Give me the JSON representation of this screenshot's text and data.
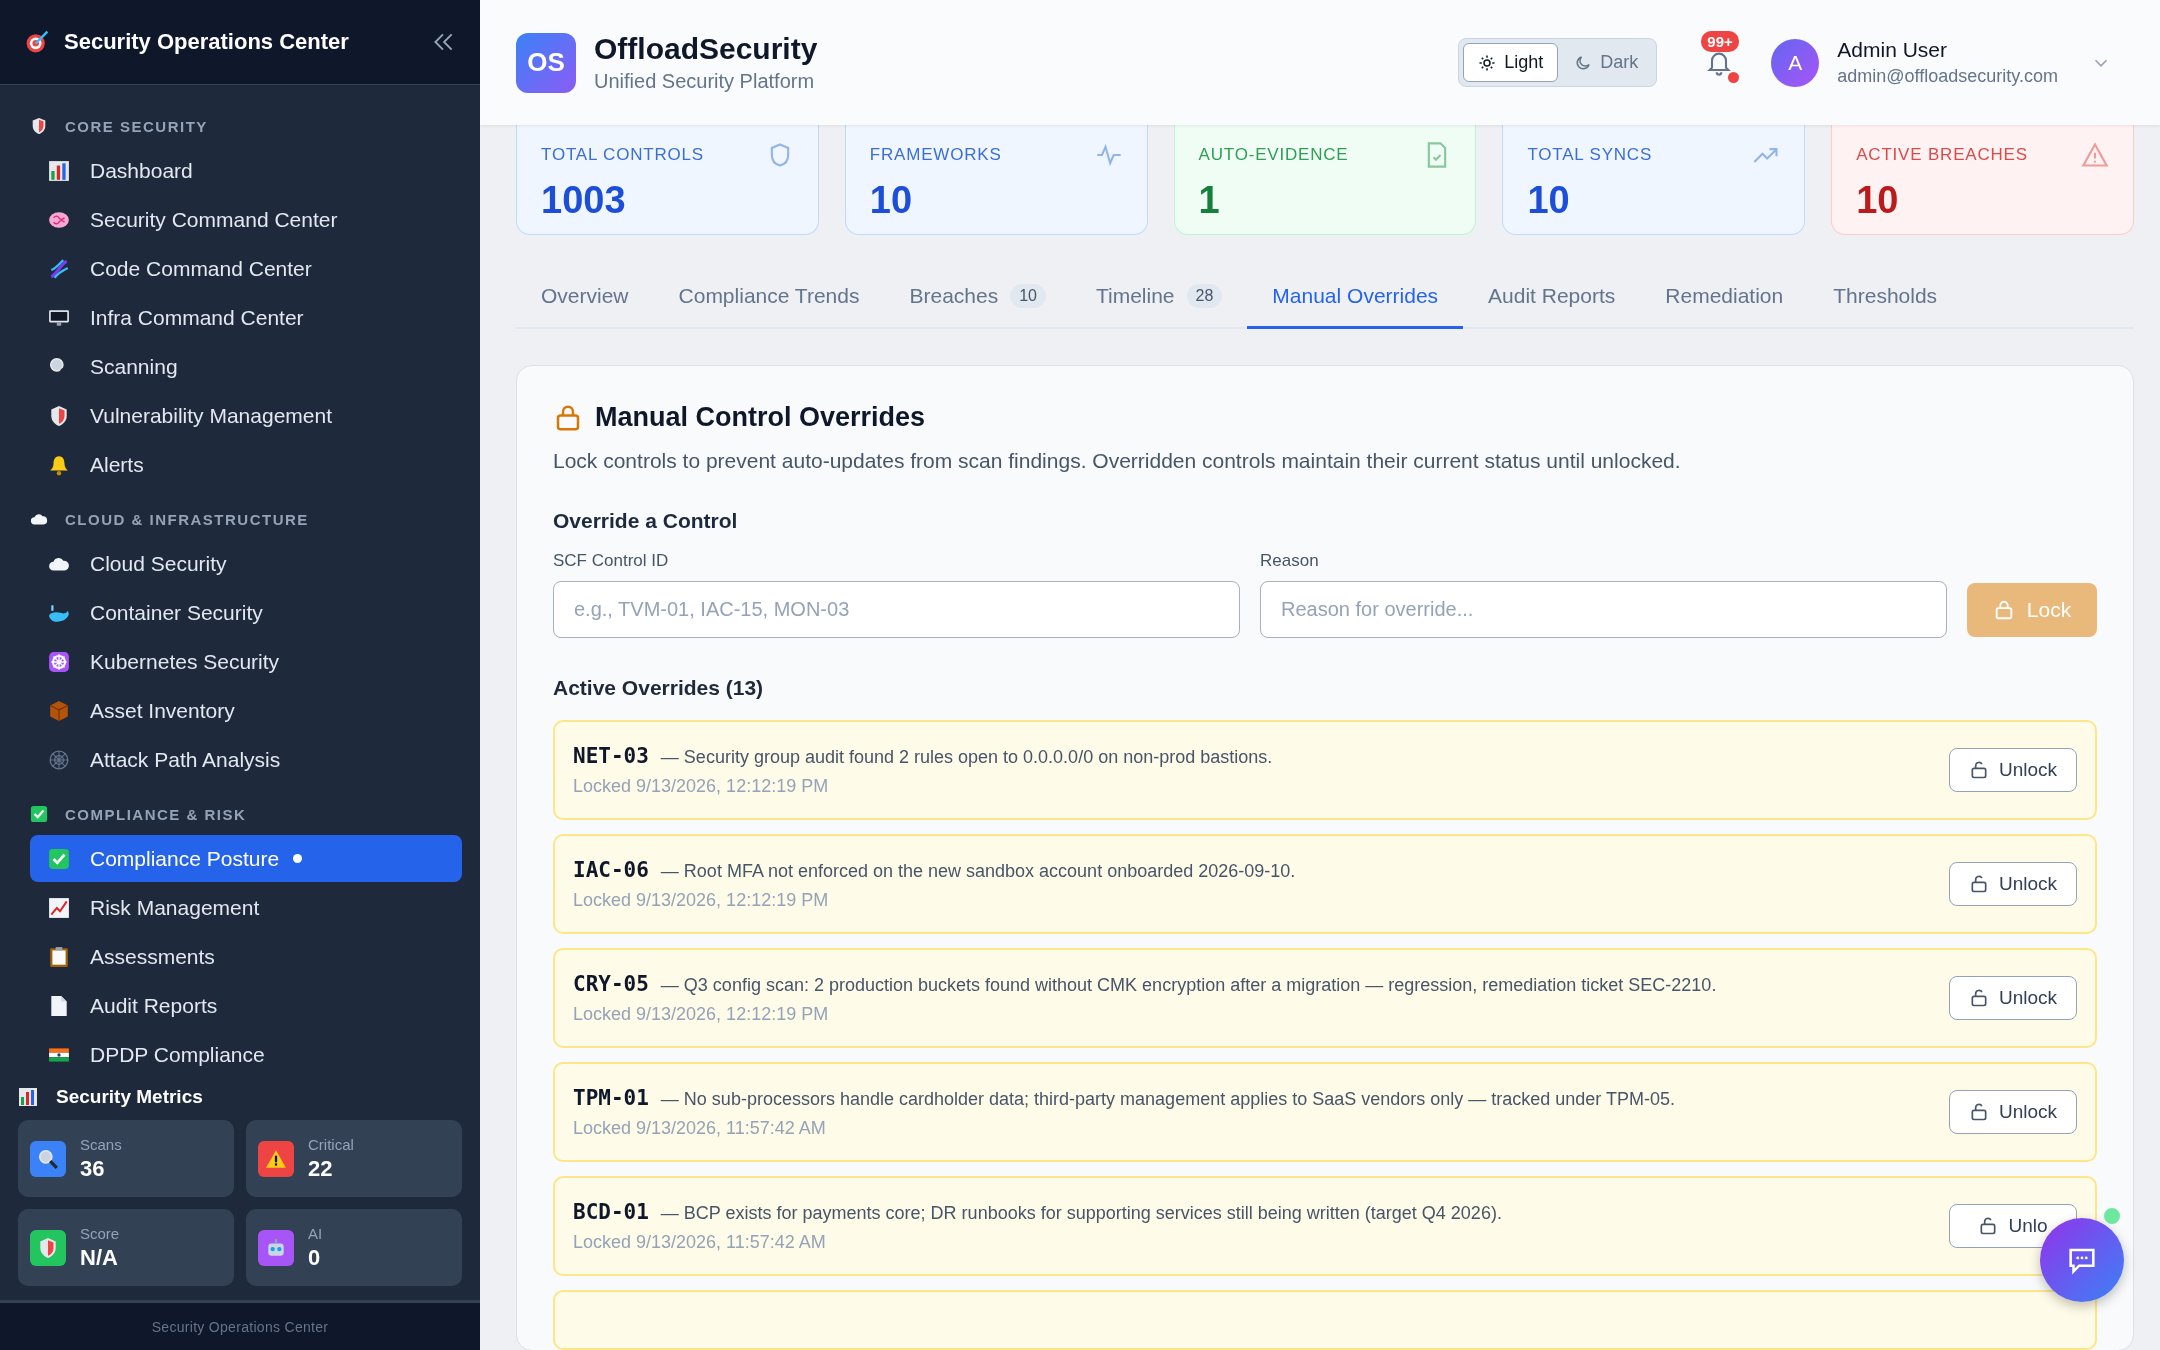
{
  "sidebar": {
    "title": "Security Operations Center",
    "sections": [
      {
        "label": "CORE SECURITY",
        "items": [
          {
            "label": "Dashboard",
            "selected": false
          },
          {
            "label": "Security Command Center",
            "selected": false
          },
          {
            "label": "Code Command Center",
            "selected": false
          },
          {
            "label": "Infra Command Center",
            "selected": false
          },
          {
            "label": "Scanning",
            "selected": false
          },
          {
            "label": "Vulnerability Management",
            "selected": false
          },
          {
            "label": "Alerts",
            "selected": false
          }
        ]
      },
      {
        "label": "CLOUD & INFRASTRUCTURE",
        "items": [
          {
            "label": "Cloud Security",
            "selected": false
          },
          {
            "label": "Container Security",
            "selected": false
          },
          {
            "label": "Kubernetes Security",
            "selected": false
          },
          {
            "label": "Asset Inventory",
            "selected": false
          },
          {
            "label": "Attack Path Analysis",
            "selected": false
          }
        ]
      },
      {
        "label": "COMPLIANCE & RISK",
        "items": [
          {
            "label": "Compliance Posture",
            "selected": true
          },
          {
            "label": "Risk Management",
            "selected": false
          },
          {
            "label": "Assessments",
            "selected": false
          },
          {
            "label": "Audit Reports",
            "selected": false
          },
          {
            "label": "DPDP Compliance",
            "selected": false
          }
        ]
      }
    ],
    "metrics_title": "Security Metrics",
    "metrics": [
      {
        "label": "Scans",
        "value": "36"
      },
      {
        "label": "Critical",
        "value": "22"
      },
      {
        "label": "Score",
        "value": "N/A"
      },
      {
        "label": "AI",
        "value": "0"
      }
    ],
    "footer": "Security Operations Center"
  },
  "header": {
    "logo": "OS",
    "title": "OffloadSecurity",
    "subtitle": "Unified Security Platform",
    "theme": [
      {
        "label": "Light",
        "selected": true
      },
      {
        "label": "Dark",
        "selected": false
      }
    ],
    "notifications": "99+",
    "user": {
      "initial": "A",
      "name": "Admin User",
      "email": "admin@offloadsecurity.com"
    }
  },
  "stats": [
    {
      "label": "TOTAL CONTROLS",
      "value": "1003",
      "kind": "info"
    },
    {
      "label": "FRAMEWORKS",
      "value": "10",
      "kind": "info"
    },
    {
      "label": "AUTO-EVIDENCE",
      "value": "1",
      "kind": "success"
    },
    {
      "label": "TOTAL SYNCS",
      "value": "10",
      "kind": "info"
    },
    {
      "label": "ACTIVE BREACHES",
      "value": "10",
      "kind": "danger"
    }
  ],
  "tabs": [
    {
      "label": "Overview",
      "selected": false
    },
    {
      "label": "Compliance Trends",
      "selected": false
    },
    {
      "label": "Breaches",
      "count": "10",
      "selected": false
    },
    {
      "label": "Timeline",
      "count": "28",
      "selected": false
    },
    {
      "label": "Manual Overrides",
      "selected": true
    },
    {
      "label": "Audit Reports",
      "selected": false
    },
    {
      "label": "Remediation",
      "selected": false
    },
    {
      "label": "Thresholds",
      "selected": false
    }
  ],
  "panel": {
    "title": "Manual Control Overrides",
    "description": "Lock controls to prevent auto-updates from scan findings. Overridden controls maintain their current status until unlocked.",
    "form_title": "Override a Control",
    "fields": [
      {
        "label": "SCF Control ID",
        "placeholder": "e.g., TVM-01, IAC-15, MON-03"
      },
      {
        "label": "Reason",
        "placeholder": "Reason for override..."
      }
    ],
    "lock_button": {
      "label": "Lock",
      "disabled": true
    },
    "list_title": "Active Overrides (13)",
    "overrides": [
      {
        "id": "NET-03",
        "reason": "— Security group audit found 2 rules open to 0.0.0.0/0 on non-prod bastions.",
        "locked": "Locked 9/13/2026, 12:12:19 PM",
        "action": "Unlock"
      },
      {
        "id": "IAC-06",
        "reason": "— Root MFA not enforced on the new sandbox account onboarded 2026-09-10.",
        "locked": "Locked 9/13/2026, 12:12:19 PM",
        "action": "Unlock"
      },
      {
        "id": "CRY-05",
        "reason": "— Q3 config scan: 2 production buckets found without CMK encryption after a migration — regression, remediation ticket SEC-2210.",
        "locked": "Locked 9/13/2026, 12:12:19 PM",
        "action": "Unlock"
      },
      {
        "id": "TPM-01",
        "reason": "— No sub-processors handle cardholder data; third-party management applies to SaaS vendors only — tracked under TPM-05.",
        "locked": "Locked 9/13/2026, 11:57:42 AM",
        "action": "Unlock"
      },
      {
        "id": "BCD-01",
        "reason": "— BCP exists for payments core; DR runbooks for supporting services still being written (target Q4 2026).",
        "locked": "Locked 9/13/2026, 11:57:42 AM",
        "action": "Unlo"
      }
    ]
  }
}
